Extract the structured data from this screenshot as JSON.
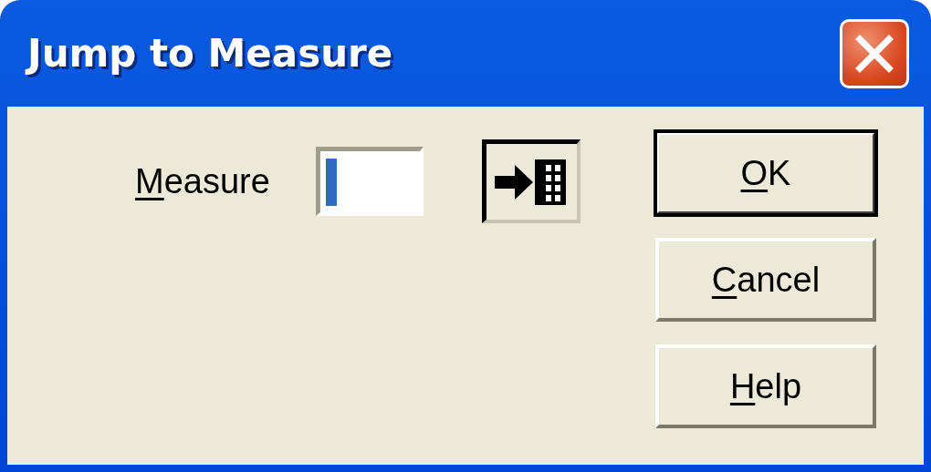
{
  "window": {
    "title": "Jump to Measure"
  },
  "field": {
    "access_key": "M",
    "label_rest": "easure"
  },
  "buttons": [
    {
      "access_key": "O",
      "label_rest": "K",
      "default": true
    },
    {
      "access_key": "C",
      "label_rest": "ancel",
      "default": false
    },
    {
      "access_key": "H",
      "label_rest": "elp",
      "default": false
    }
  ]
}
